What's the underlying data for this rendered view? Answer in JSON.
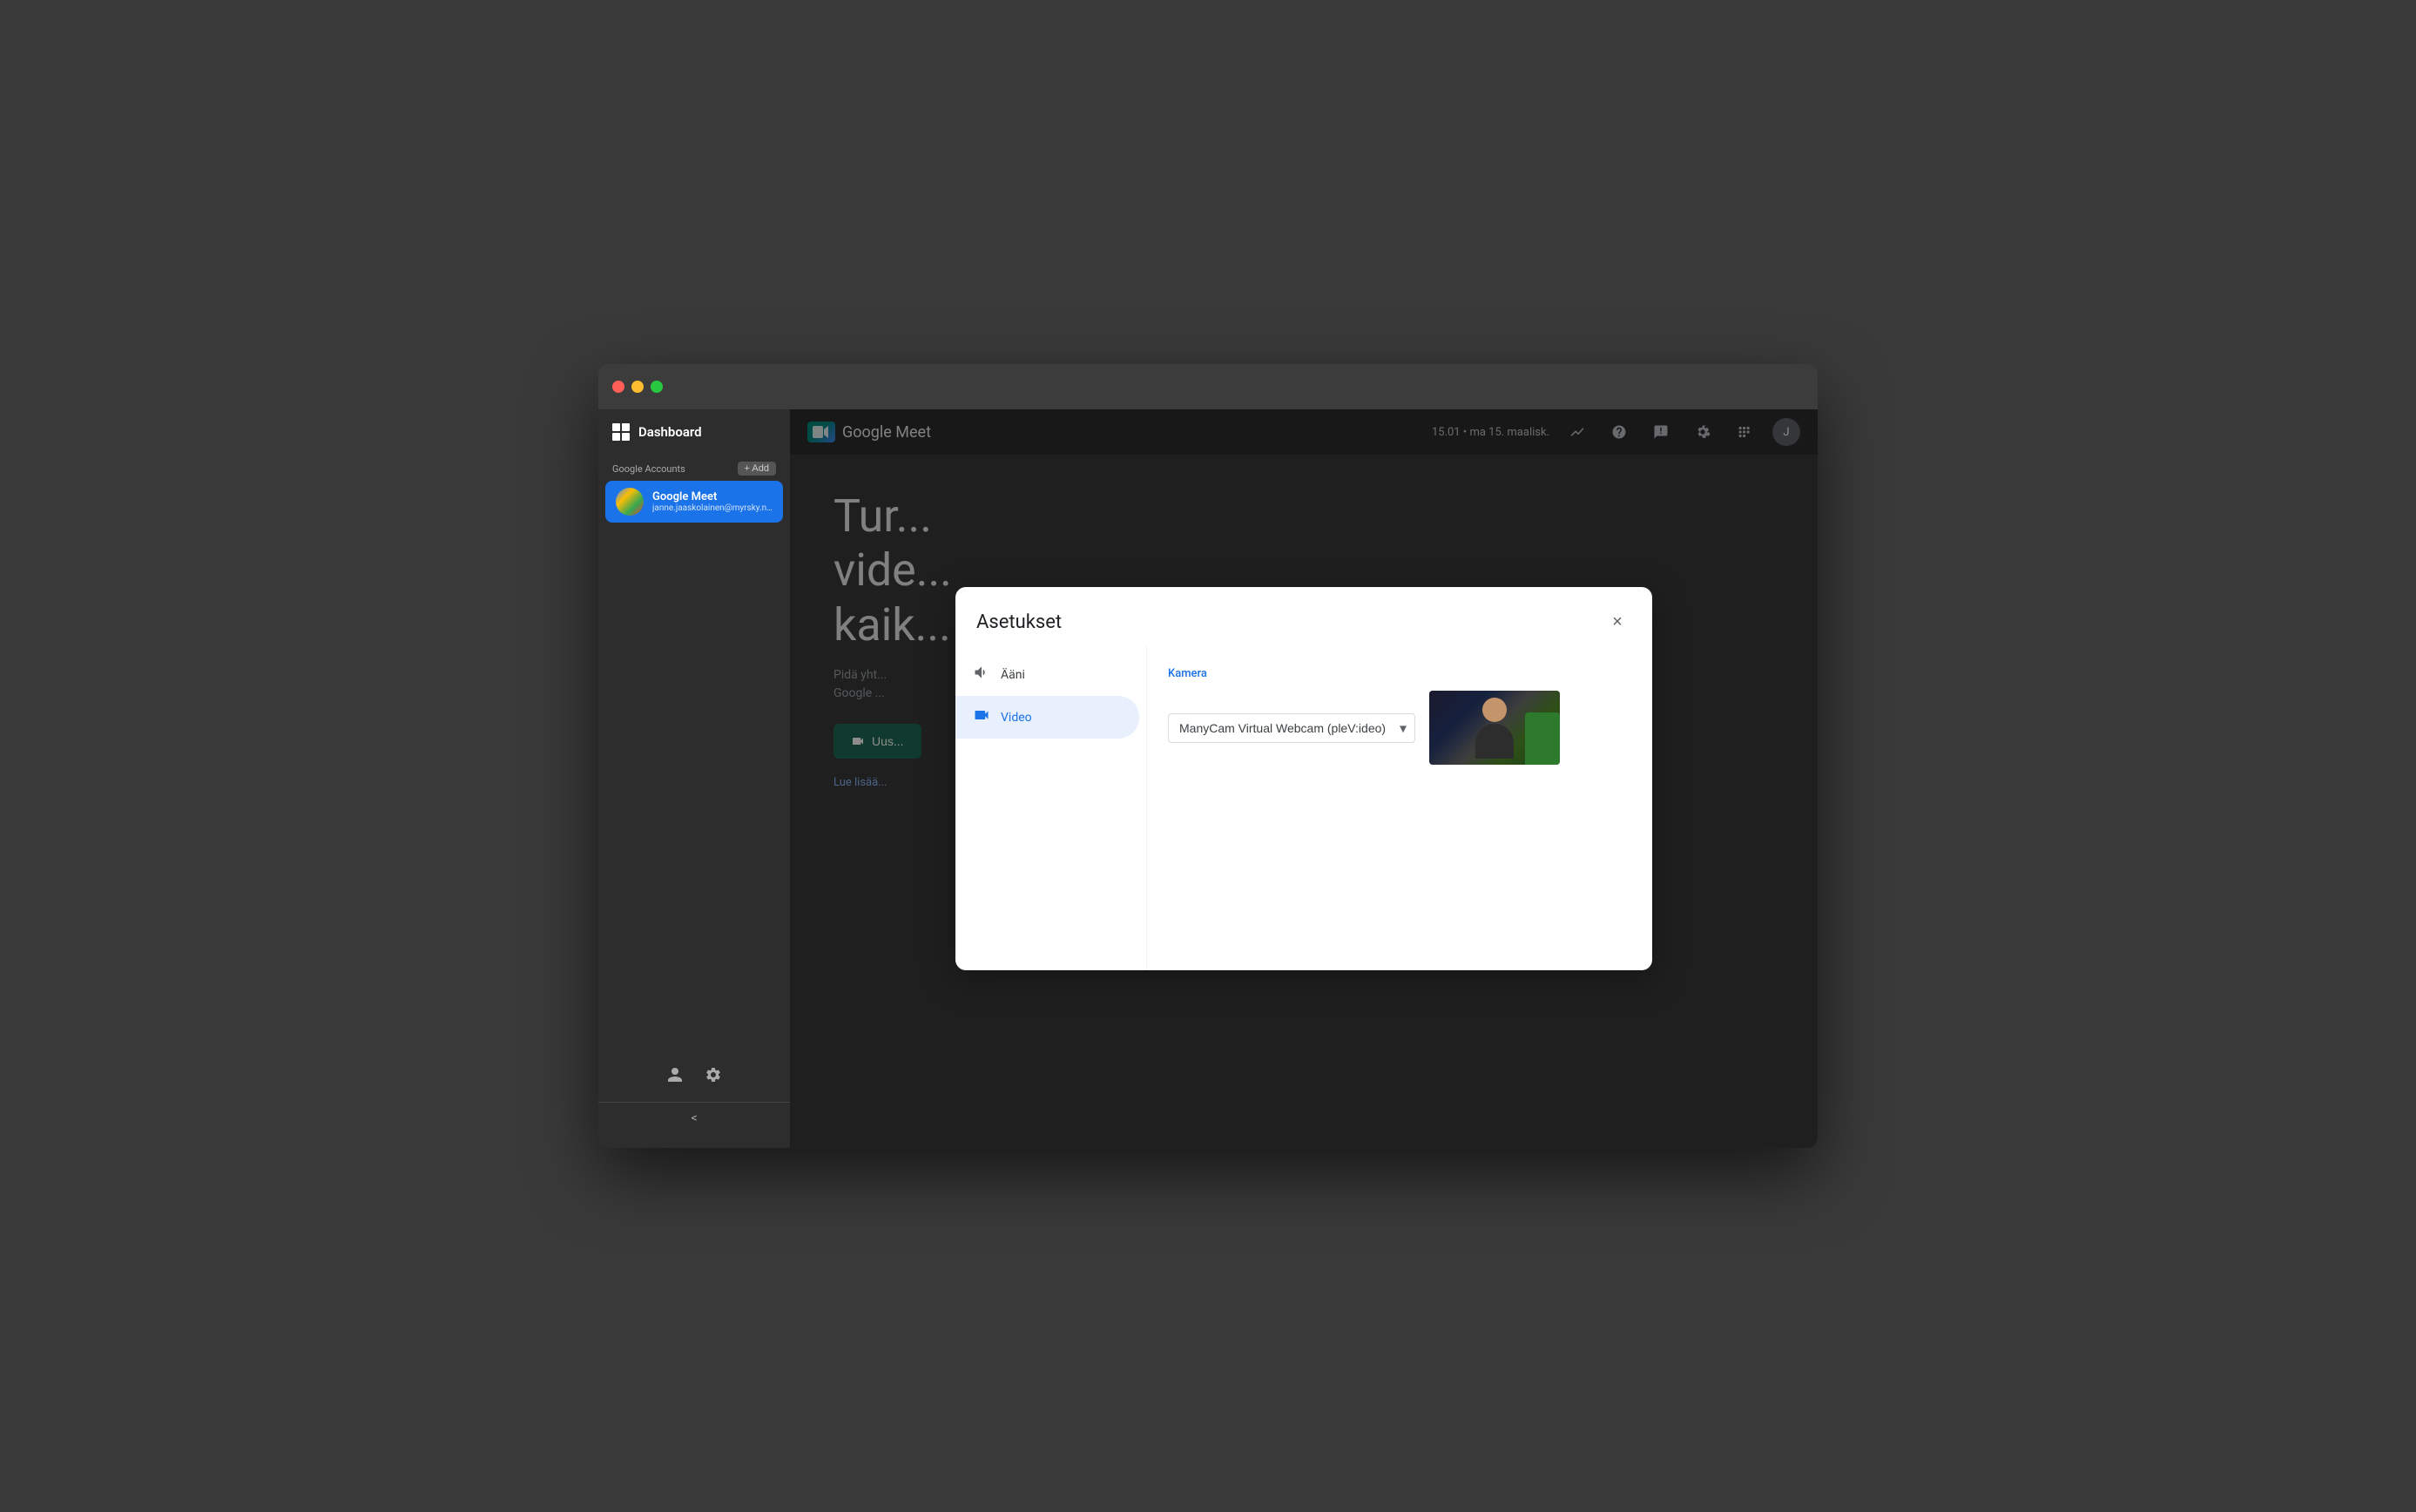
{
  "window": {
    "title": "Google Meet"
  },
  "traffic_lights": {
    "red": "#ff5f57",
    "yellow": "#febc2e",
    "green": "#28c840"
  },
  "sidebar": {
    "dashboard_label": "Dashboard",
    "accounts_label": "Google Accounts",
    "add_button_label": "+ Add",
    "account": {
      "name": "Google Meet",
      "email": "janne.jaaskolainen@myrsky.net"
    },
    "footer_icons": [
      "person",
      "gear"
    ],
    "collapse_label": "<"
  },
  "meet_header": {
    "logo_text": "Google Meet",
    "datetime": "15.01 • ma 15. maalisk.",
    "icons": [
      "trend-up",
      "question",
      "chat",
      "settings",
      "apps-grid",
      "user-avatar"
    ]
  },
  "meet_content": {
    "hero_title": "Tur...\nvide...\nkaik...",
    "hero_subtitle": "Pidä yht...\nGoogle ...",
    "new_meeting_button": "Uus...",
    "learn_more_link": "Lue lisää..."
  },
  "settings_dialog": {
    "title": "Asetukset",
    "close_button_label": "×",
    "nav_items": [
      {
        "id": "audio",
        "label": "Ääni",
        "icon": "speaker"
      },
      {
        "id": "video",
        "label": "Video",
        "icon": "video-camera",
        "active": true
      }
    ],
    "video_section": {
      "camera_label": "Kamera",
      "camera_selected": "ManyCam Virtual Webcam (pleV:ideo)",
      "camera_options": [
        "ManyCam Virtual Webcam (pleV:ideo)"
      ]
    }
  }
}
